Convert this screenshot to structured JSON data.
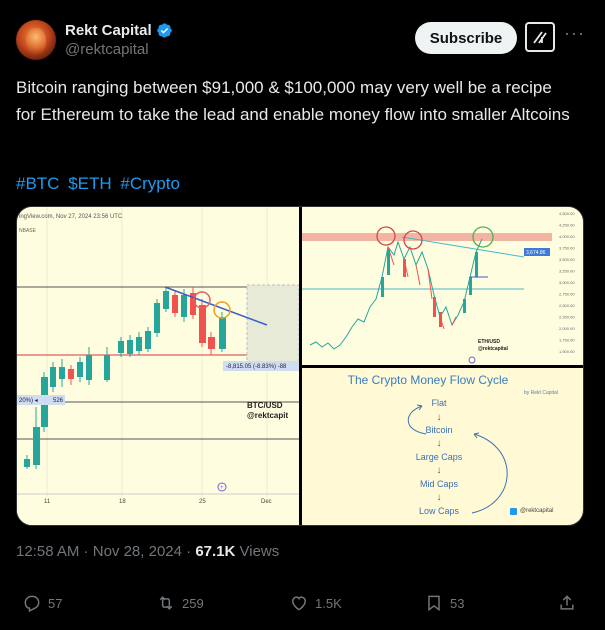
{
  "author": {
    "name": "Rekt Capital",
    "handle": "@rektcapital"
  },
  "buttons": {
    "subscribe": "Subscribe",
    "more": "···"
  },
  "post": {
    "text": "Bitcoin ranging between $91,000 & $100,000 may very well be a recipe for Ethereum to take the lead and enable money flow into smaller Altcoins",
    "hashtags": [
      "#BTC",
      "$ETH",
      "#Crypto"
    ]
  },
  "images": {
    "btc_chart": {
      "header": "ingView.com, Nov 27, 2024 23:56 UTC",
      "exchange": "NBASE",
      "measure_label": "-8,815.05 (-8.83%) -88",
      "left_label": "20%) ◂",
      "left_value": "526",
      "pair": "BTC/USD",
      "brand": "@rektcapit",
      "x_ticks": [
        "11",
        "18",
        "25",
        "Dec"
      ]
    },
    "eth_chart": {
      "pair": "ETH/USD",
      "brand": "@rektcapital",
      "price_tag": "3,674.86",
      "y_ticks": [
        "4,500.00",
        "4,250.00",
        "4,000.00",
        "3,750.00",
        "3,500.00",
        "3,250.00",
        "3,000.00",
        "2,750.00",
        "2,500.00",
        "2,250.00",
        "2,000.00",
        "1,750.00",
        "1,500.00"
      ]
    },
    "flow_cycle": {
      "title": "The Crypto Money Flow Cycle",
      "byline": "by Rekt Capital",
      "stages": [
        "Flat",
        "Bitcoin",
        "Large Caps",
        "Mid Caps",
        "Low Caps"
      ],
      "handle": "@rektcapital"
    }
  },
  "meta": {
    "time": "12:58 AM",
    "date": "Nov 28, 2024",
    "views_count": "67.1K",
    "views_label": "Views"
  },
  "actions": {
    "replies": "57",
    "reposts": "259",
    "likes": "1.5K",
    "bookmarks": "53"
  },
  "colors": {
    "accent": "#1d9bf0",
    "muted": "#71767b",
    "bull": "#26a69a",
    "bear": "#ef5350"
  }
}
